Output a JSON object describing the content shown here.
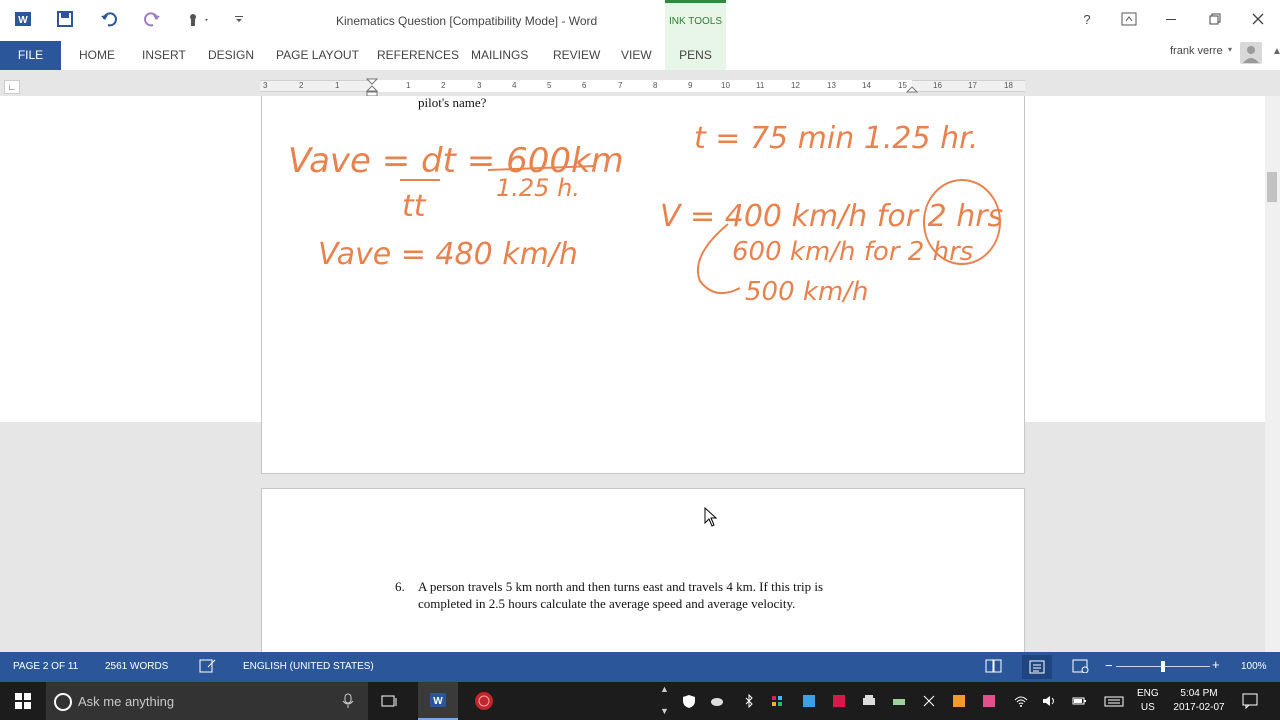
{
  "title_bar": {
    "document_title": "Kinematics Question [Compatibility Mode] - Word",
    "contextual_group": "INK TOOLS",
    "help_glyph": "?"
  },
  "ribbon": {
    "file_tab": "FILE",
    "tabs": [
      "HOME",
      "INSERT",
      "DESIGN",
      "PAGE LAYOUT",
      "REFERENCES",
      "MAILINGS",
      "REVIEW",
      "VIEW",
      "PENS"
    ],
    "user_name": "frank verre"
  },
  "ruler": {
    "numbers": [
      "3",
      "2",
      "1",
      "1",
      "2",
      "3",
      "4",
      "5",
      "6",
      "7",
      "8",
      "9",
      "10",
      "11",
      "12",
      "13",
      "14",
      "15",
      "16",
      "17",
      "18"
    ]
  },
  "document": {
    "previous_text_fragment": "pilot's name?",
    "question_number": "6.",
    "question_line_1": "A person travels 5 km north and then turns east and travels 4 km. If this trip is",
    "question_line_2": "completed in 2.5 hours calculate the average speed and average velocity.",
    "ink_notes": {
      "left_1": "Vave = dt = 600km",
      "left_1_denominator": "tt",
      "left_1_rhs_denominator": "1.25 h.",
      "left_2": "Vave = 480 km/h",
      "right_1": "t = 75 min  1.25 hr.",
      "right_2": "V = 400 km/h for 2 hrs",
      "right_3": "600 km/h for 2 hrs",
      "right_4": "500 km/h"
    }
  },
  "status_bar": {
    "page": "PAGE 2 OF 11",
    "words": "2561 WORDS",
    "language": "ENGLISH (UNITED STATES)",
    "zoom": "100%"
  },
  "taskbar": {
    "search_placeholder": "Ask me anything",
    "lang_line1": "ENG",
    "lang_line2": "US",
    "time": "5:04 PM",
    "date": "2017-02-07"
  },
  "colors": {
    "word_blue": "#2b579a",
    "ink_orange": "#e8834f",
    "ink_tools_green": "#2e8b3e"
  }
}
